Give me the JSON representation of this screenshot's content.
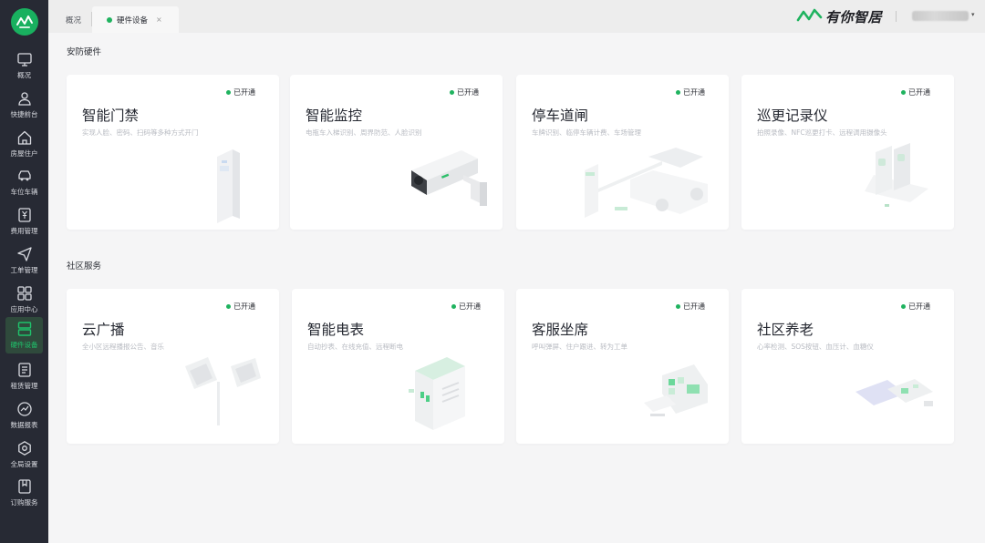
{
  "sidebar": {
    "items": [
      {
        "label": "概况",
        "icon": "monitor-icon"
      },
      {
        "label": "快捷前台",
        "icon": "person-icon"
      },
      {
        "label": "房屋住户",
        "icon": "house-icon"
      },
      {
        "label": "车位车辆",
        "icon": "car-icon"
      },
      {
        "label": "费用管理",
        "icon": "yuan-icon"
      },
      {
        "label": "工单管理",
        "icon": "send-icon"
      },
      {
        "label": "应用中心",
        "icon": "grid-icon"
      },
      {
        "label": "硬件设备",
        "icon": "device-icon"
      },
      {
        "label": "租赁管理",
        "icon": "document-icon"
      },
      {
        "label": "数据报表",
        "icon": "chart-icon"
      },
      {
        "label": "全局设置",
        "icon": "settings-icon"
      },
      {
        "label": "订购服务",
        "icon": "bookmark-icon"
      }
    ],
    "active_index": 7
  },
  "tabs": {
    "overview": "概况",
    "hardware": "硬件设备",
    "close": "×"
  },
  "brand": {
    "name": "有你智居"
  },
  "sections": [
    {
      "title": "安防硬件",
      "cards": [
        {
          "title": "智能门禁",
          "desc": "实现人脸、密码、扫码等多种方式开门",
          "status": "已开通"
        },
        {
          "title": "智能监控",
          "desc": "电瓶车入梯识别、周界防范、人脸识别",
          "status": "已开通"
        },
        {
          "title": "停车道闸",
          "desc": "车牌识别、临停车辆计费、车场管理",
          "status": "已开通"
        },
        {
          "title": "巡更记录仪",
          "desc": "拍照录像、NFC巡更打卡、远程调用摄像头",
          "status": "已开通"
        }
      ]
    },
    {
      "title": "社区服务",
      "cards": [
        {
          "title": "云广播",
          "desc": "全小区远程播报公告、音乐",
          "status": "已开通"
        },
        {
          "title": "智能电表",
          "desc": "自动抄表、在线充值、远程断电",
          "status": "已开通"
        },
        {
          "title": "客服坐席",
          "desc": "呼叫弹屏、住户跟进、转为工单",
          "status": "已开通"
        },
        {
          "title": "社区养老",
          "desc": "心率检测、SOS按钮、血压计、血糖仪",
          "status": "已开通"
        }
      ]
    }
  ],
  "colors": {
    "accent": "#1fb35f",
    "sidebar_bg": "#272a34"
  }
}
